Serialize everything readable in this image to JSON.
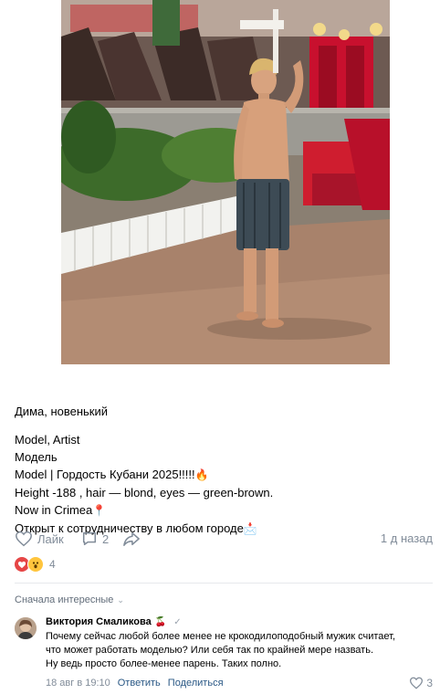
{
  "post": {
    "author_line": "Дима, новенький",
    "lines": [
      "Model, Artist",
      "Модель",
      "Model | Гордость Кубани 2025!!!!!",
      "Height -188 , hair — blond, eyes — green-brown.",
      "Now in Crimea",
      "Открыт к сотрудничеству в любом городе"
    ],
    "emoji_names": [
      "fire-emoji",
      "pin-emoji",
      "envelope-emoji"
    ]
  },
  "actions": {
    "like_label": "Лайк",
    "comments_count": "2",
    "time": "1 д назад"
  },
  "reactions": {
    "count": "4"
  },
  "comments": {
    "sort_label": "Сначала интересные",
    "items": [
      {
        "author": "Виктория Смаликова",
        "text_lines": [
          "Почему сейчас любой более менее не крокодилоподобный мужик считает,",
          "что может работать моделью? Или себя так по крайней мере назвать.",
          "Ну ведь просто более-менее парень. Таких полно."
        ],
        "date": "18 авг в 19:10",
        "reply_label": "Ответить",
        "share_label": "Поделиться",
        "likes": "3"
      }
    ]
  },
  "colors": {
    "muted": "#818c99",
    "link": "#2a5885",
    "heart": "#e64646",
    "divider": "#e7e8ec"
  }
}
